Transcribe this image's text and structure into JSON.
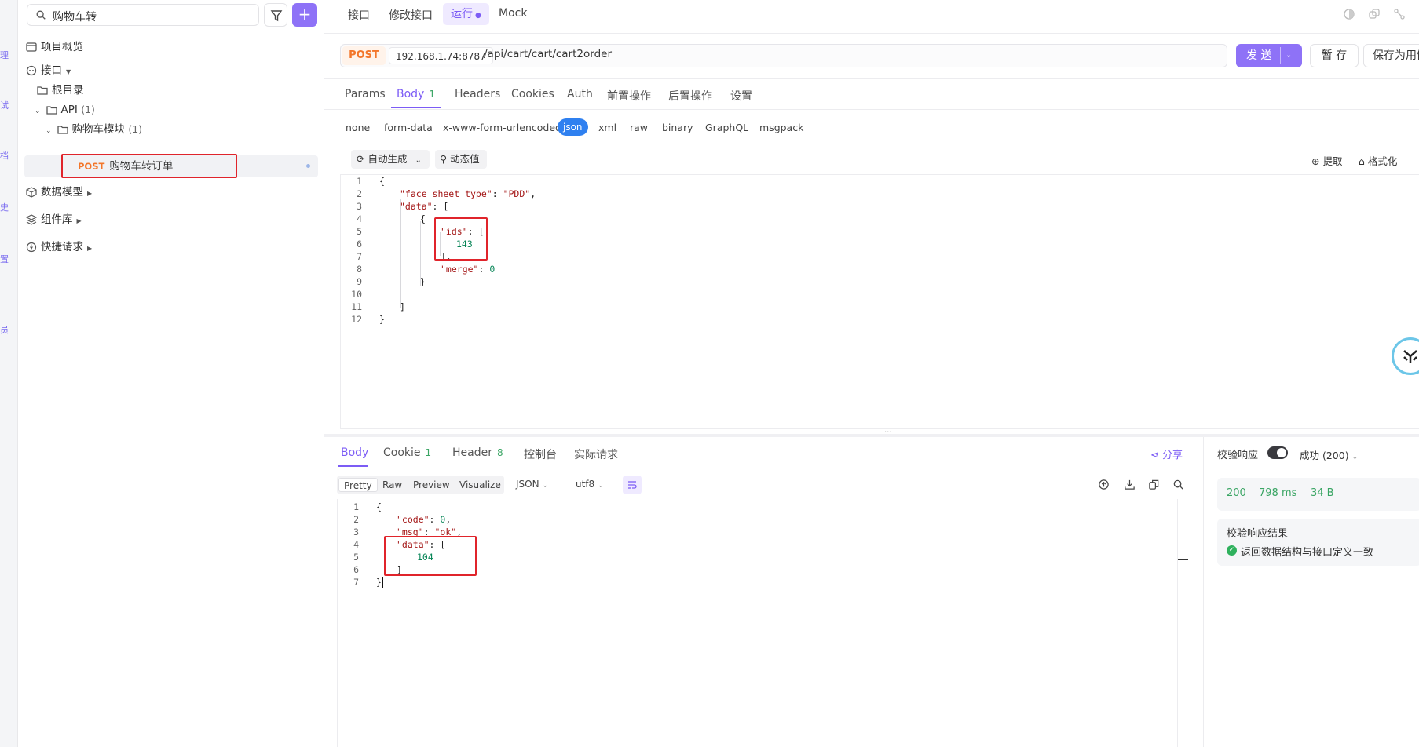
{
  "sidebar": {
    "search_value": "购物车转",
    "items": [
      {
        "label": "项目概览"
      },
      {
        "label": "接口"
      },
      {
        "label": "根目录"
      },
      {
        "label": "API",
        "count": "(1)"
      },
      {
        "label": "购物车模块",
        "count": "(1)"
      },
      {
        "method": "POST",
        "label": "购物车转订单"
      },
      {
        "label": "数据模型"
      },
      {
        "label": "组件库"
      },
      {
        "label": "快捷请求"
      }
    ]
  },
  "top_tabs": [
    "接口",
    "修改接口",
    "运行",
    "Mock"
  ],
  "request": {
    "method": "POST",
    "host": "192.168.1.74:8787",
    "path": "/api/cart/cart/cart2order",
    "send_label": "发 送",
    "save_tmp_label": "暂 存",
    "save_case_label": "保存为用例",
    "tabs": [
      {
        "label": "Params"
      },
      {
        "label": "Body",
        "badge": "1"
      },
      {
        "label": "Headers"
      },
      {
        "label": "Cookies"
      },
      {
        "label": "Auth"
      },
      {
        "label": "前置操作"
      },
      {
        "label": "后置操作"
      },
      {
        "label": "设置"
      }
    ],
    "body_types": [
      "none",
      "form-data",
      "x-www-form-urlencoded",
      "json",
      "xml",
      "raw",
      "binary",
      "GraphQL",
      "msgpack"
    ],
    "auto_gen_label": "自动生成",
    "dynamic_label": "动态值",
    "extract_label": "提取",
    "format_label": "格式化",
    "code_lines": [
      "{",
      "    \"face_sheet_type\": \"PDD\",",
      "    \"data\": [",
      "        {",
      "            \"ids\": [",
      "                143",
      "            ],",
      "            \"merge\": 0",
      "        }",
      "",
      "    ]",
      "}"
    ]
  },
  "response": {
    "tabs": [
      {
        "label": "Body"
      },
      {
        "label": "Cookie",
        "badge": "1"
      },
      {
        "label": "Header",
        "badge": "8"
      },
      {
        "label": "控制台"
      },
      {
        "label": "实际请求"
      }
    ],
    "share_label": "分享",
    "view_modes": [
      "Pretty",
      "Raw",
      "Preview",
      "Visualize"
    ],
    "format": "JSON",
    "encoding": "utf8",
    "code_lines": [
      "{",
      "    \"code\": 0,",
      "    \"msg\": \"ok\",",
      "    \"data\": [",
      "        104",
      "    ]",
      "}"
    ],
    "validate_label": "校验响应",
    "validate_status": "成功 (200)",
    "status_code": "200",
    "time": "798 ms",
    "size": "34 B",
    "validate_result_title": "校验响应结果",
    "validate_result_text": "返回数据结构与接口定义一致"
  },
  "colors": {
    "accent": "#8e72f7",
    "post": "#f3762a",
    "highlight": "#e0242b",
    "success": "#3aa564"
  }
}
